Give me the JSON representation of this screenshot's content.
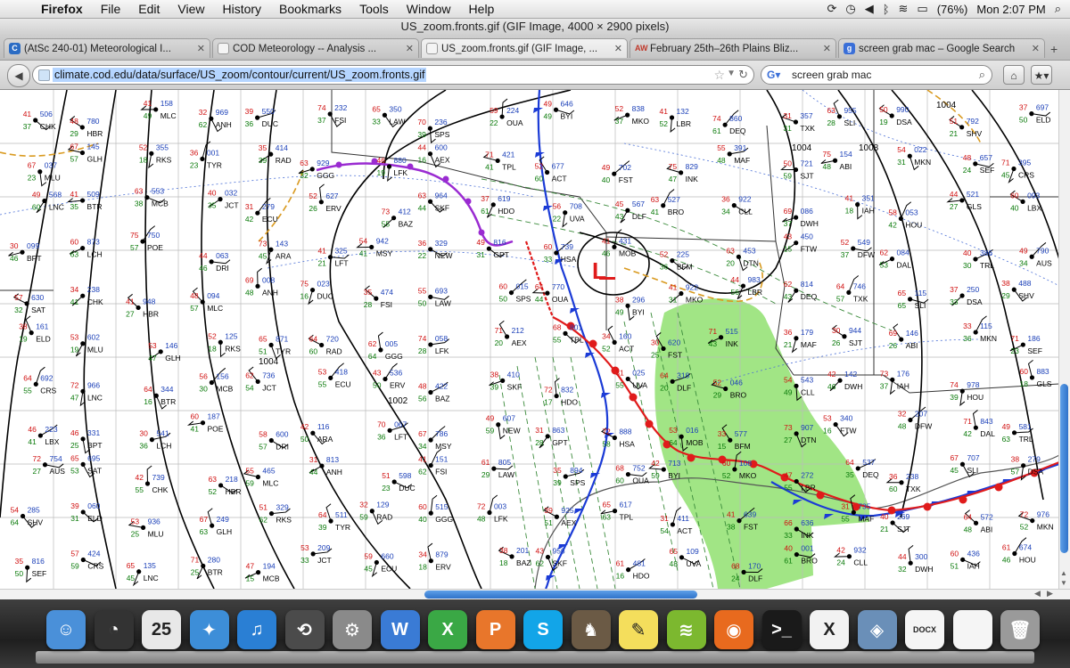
{
  "menubar": {
    "app_name": "Firefox",
    "items": [
      "File",
      "Edit",
      "View",
      "History",
      "Bookmarks",
      "Tools",
      "Window",
      "Help"
    ],
    "battery": "(76%)",
    "clock": "Mon 2:07 PM"
  },
  "window": {
    "title": "US_zoom.fronts.gif (GIF Image, 4000 × 2900 pixels)"
  },
  "tabs": [
    {
      "label": "(AtSc 240-01) Meteorological I...",
      "fav": "C",
      "color": "#2b6cc4"
    },
    {
      "label": "COD Meteorology -- Analysis ...",
      "fav": "",
      "color": "#dddddd"
    },
    {
      "label": "US_zoom.fronts.gif (GIF Image, ...",
      "fav": "",
      "color": "#dddddd"
    },
    {
      "label": "February 25th–26th Plains Bliz...",
      "fav": "AW",
      "color": "#c0392b"
    },
    {
      "label": "screen grab mac – Google Search",
      "fav": "g",
      "color": "#3a6fd8"
    }
  ],
  "navbar": {
    "url": "climate.cod.edu/data/surface/US_zoom/contour/current/US_zoom.fronts.gif",
    "search_text": "screen grab mac"
  },
  "map": {
    "station_ids": [
      "CHK",
      "HBR",
      "MLC",
      "ANH",
      "DUC",
      "FSI",
      "LAW",
      "SPS",
      "OUA",
      "BYI",
      "MKO",
      "LBR",
      "DEQ",
      "TXK",
      "SLI",
      "DSA",
      "SHV",
      "ELD",
      "MLU",
      "GLH",
      "RKS",
      "TYR",
      "RAD",
      "GGG",
      "LFK",
      "AEX",
      "TPL",
      "ACT",
      "FST",
      "INK",
      "MAF",
      "SJT",
      "ABI",
      "MKN",
      "SEF",
      "CRS",
      "LNC",
      "BTR",
      "MCB",
      "JCT",
      "ECU",
      "ERV",
      "BAZ",
      "SKF",
      "HDO",
      "UVA",
      "DLF",
      "BRO",
      "CLL",
      "DWH",
      "IAH",
      "HOU",
      "GLS",
      "LBX",
      "BPT",
      "LCH",
      "POE",
      "DRI",
      "ARA",
      "LFT",
      "MSY",
      "NEW",
      "GPT",
      "HSA",
      "MOB",
      "BFM",
      "DTN",
      "FTW",
      "DFW",
      "DAL",
      "TRL",
      "AUS",
      "SAT"
    ],
    "pressure_labels": [
      "1004",
      "1008",
      "1004",
      "1002",
      "1004"
    ],
    "low_label": "L"
  },
  "dock": {
    "icons": [
      {
        "name": "finder-icon",
        "glyph": "☺",
        "color": "#4a90d9"
      },
      {
        "name": "dashboard-icon",
        "glyph": "◔",
        "color": "#333333"
      },
      {
        "name": "ical-icon",
        "glyph": "25",
        "color": "#e8e8e8"
      },
      {
        "name": "safari-icon",
        "glyph": "✦",
        "color": "#3d8ed8"
      },
      {
        "name": "itunes-icon",
        "glyph": "♫",
        "color": "#2a7fd4"
      },
      {
        "name": "time-machine-icon",
        "glyph": "⟲",
        "color": "#4b4b4b"
      },
      {
        "name": "system-preferences-icon",
        "glyph": "⚙",
        "color": "#8a8a8a"
      },
      {
        "name": "word-icon",
        "glyph": "W",
        "color": "#3a7bd5"
      },
      {
        "name": "excel-icon",
        "glyph": "X",
        "color": "#3aa845"
      },
      {
        "name": "powerpoint-icon",
        "glyph": "P",
        "color": "#e8762b"
      },
      {
        "name": "skype-icon",
        "glyph": "S",
        "color": "#12a5e8"
      },
      {
        "name": "chess-icon",
        "glyph": "♞",
        "color": "#6b5a45"
      },
      {
        "name": "stickies-icon",
        "glyph": "✎",
        "color": "#f4de5c"
      },
      {
        "name": "spotify-icon",
        "glyph": "≋",
        "color": "#7cb82f"
      },
      {
        "name": "firefox-icon",
        "glyph": "◉",
        "color": "#e86a1e"
      },
      {
        "name": "terminal-icon",
        "glyph": ">_",
        "color": "#1a1a1a"
      },
      {
        "name": "x11-icon",
        "glyph": "X",
        "color": "#f2f2f2"
      },
      {
        "name": "preview-icon",
        "glyph": "◈",
        "color": "#6a8fb8"
      },
      {
        "name": "document-icon",
        "glyph": "DOCX",
        "color": "#f5f5f5"
      },
      {
        "name": "blank-document-icon",
        "glyph": "",
        "color": "#f5f5f5"
      },
      {
        "name": "trash-icon",
        "glyph": "🗑",
        "color": "#9a9a9a"
      }
    ]
  }
}
